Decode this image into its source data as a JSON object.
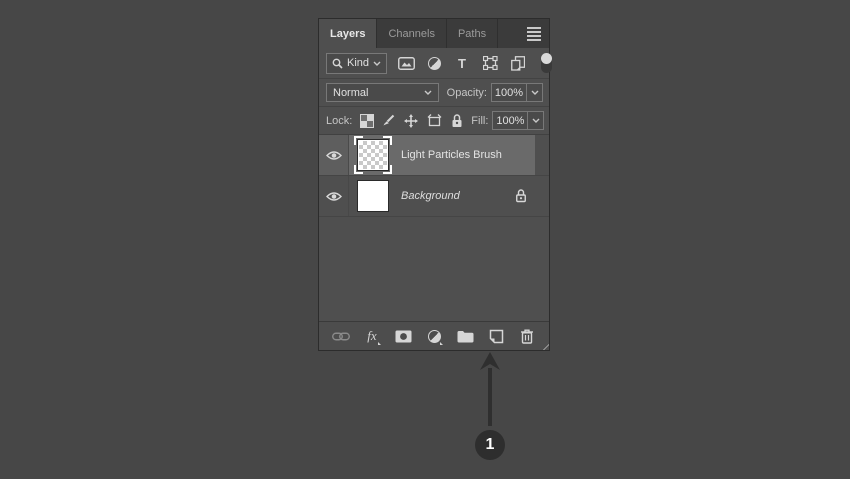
{
  "panel": {
    "tabs": [
      {
        "label": "Layers",
        "active": true
      },
      {
        "label": "Channels",
        "active": false
      },
      {
        "label": "Paths",
        "active": false
      }
    ],
    "filter_row": {
      "kind_label": "Kind",
      "type_filter_glyph": "T",
      "filter_icons": [
        "pixel-layers-filter",
        "adjustment-layers-filter",
        "type-layers-filter",
        "shape-layers-filter",
        "smart-objects-filter"
      ],
      "filter_toggle": "layer-filtering-toggle"
    },
    "blend_row": {
      "blend_mode": "Normal",
      "opacity_label": "Opacity:",
      "opacity_value": "100%"
    },
    "lock_row": {
      "lock_label": "Lock:",
      "lock_icons": [
        "lock-transparent-pixels",
        "lock-image-pixels",
        "lock-position",
        "lock-artboard-nesting",
        "lock-all"
      ],
      "fill_label": "Fill:",
      "fill_value": "100%"
    },
    "layers": [
      {
        "name": "Light Particles Brush",
        "selected": true,
        "visible": true,
        "thumbnail": "transparent-checkerboard",
        "locked": false
      },
      {
        "name": "Background",
        "selected": false,
        "visible": true,
        "thumbnail": "white",
        "locked": true
      }
    ],
    "bottom_bar": {
      "fx_glyph": "fx",
      "icons": [
        "link-layers",
        "layer-style-fx",
        "add-layer-mask",
        "new-adjustment-layer",
        "new-group",
        "new-layer",
        "delete-layer"
      ]
    }
  },
  "annotation": {
    "label": "1"
  },
  "colors": {
    "background": "#474747",
    "panel_bg": "#4f4f4f",
    "tab_strip": "#3b3b3b",
    "selected_row": "#6a6a6a",
    "field_border": "#787878",
    "text": "#e0e0e0",
    "muted_text": "#9b9b9b",
    "annotation_circle": "#2e2e2e"
  }
}
